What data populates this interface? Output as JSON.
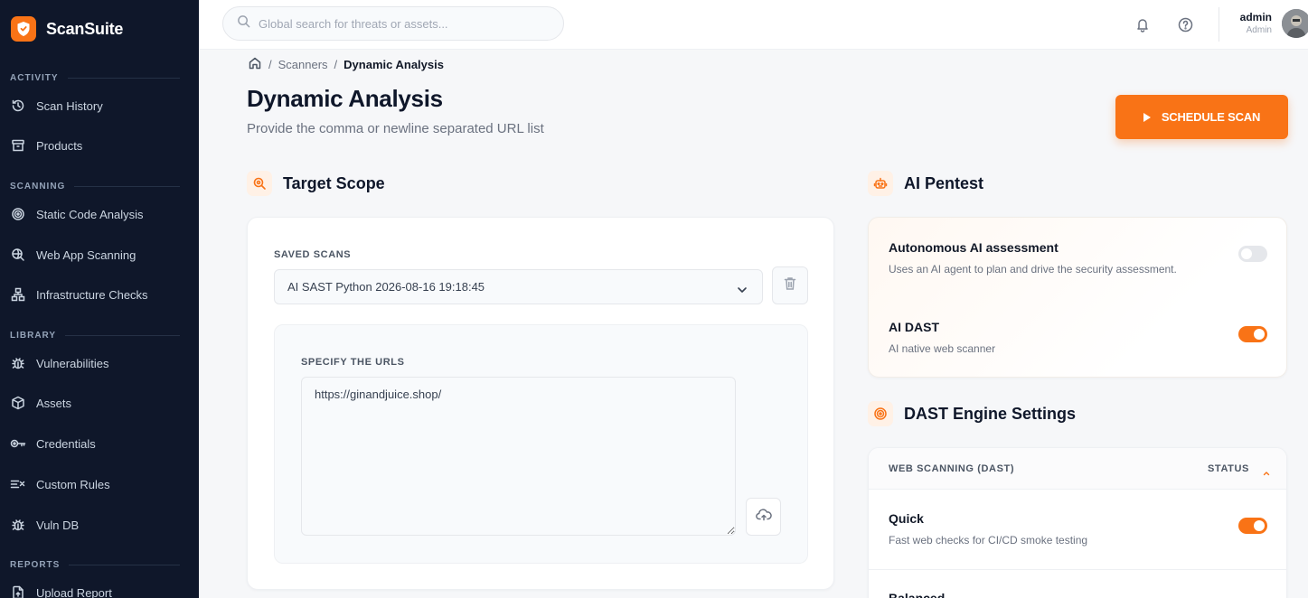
{
  "brand": {
    "name": "ScanSuite"
  },
  "sidebar": {
    "sections": [
      {
        "label": "ACTIVITY"
      },
      {
        "label": "SCANNING"
      },
      {
        "label": "LIBRARY"
      },
      {
        "label": "REPORTS"
      }
    ],
    "items": [
      {
        "label": "Scan History",
        "icon": "history-icon"
      },
      {
        "label": "Products",
        "icon": "archive-icon"
      },
      {
        "label": "Static Code Analysis",
        "icon": "target-icon"
      },
      {
        "label": "Web App Scanning",
        "icon": "web-scan-icon"
      },
      {
        "label": "Infrastructure Checks",
        "icon": "network-icon"
      },
      {
        "label": "Vulnerabilities",
        "icon": "bug-icon"
      },
      {
        "label": "Assets",
        "icon": "cube-icon"
      },
      {
        "label": "Credentials",
        "icon": "key-icon"
      },
      {
        "label": "Custom Rules",
        "icon": "rules-icon"
      },
      {
        "label": "Vuln DB",
        "icon": "bug-icon"
      },
      {
        "label": "Upload Report",
        "icon": "upload-file-icon"
      }
    ]
  },
  "topbar": {
    "search_placeholder": "Global search for threats or assets...",
    "user_name": "admin",
    "user_role": "Admin"
  },
  "breadcrumb": {
    "parent": "Scanners",
    "current": "Dynamic Analysis"
  },
  "page": {
    "title": "Dynamic Analysis",
    "subtitle": "Provide the comma or newline separated URL list",
    "schedule_button": "SCHEDULE SCAN"
  },
  "target_scope": {
    "title": "Target Scope",
    "saved_scans_label": "SAVED SCANS",
    "saved_scan_selected": "AI SAST Python 2026-08-16 19:18:45",
    "urls_label": "SPECIFY THE URLS",
    "urls_value": "https://ginandjuice.shop/"
  },
  "ai_pentest": {
    "title": "AI Pentest",
    "options": [
      {
        "title": "Autonomous AI assessment",
        "desc": "Uses an AI agent to plan and drive the security assessment.",
        "enabled": false
      },
      {
        "title": "AI DAST",
        "desc": "AI native web scanner",
        "enabled": true
      }
    ]
  },
  "dast_engine": {
    "title": "DAST Engine Settings",
    "col_left": "WEB SCANNING (DAST)",
    "col_right": "STATUS",
    "rows": [
      {
        "title": "Quick",
        "desc": "Fast web checks for CI/CD smoke testing",
        "enabled": true
      },
      {
        "title": "Balanced"
      }
    ]
  },
  "colors": {
    "accent": "#f97316",
    "sidebar_bg": "#0f172a"
  }
}
